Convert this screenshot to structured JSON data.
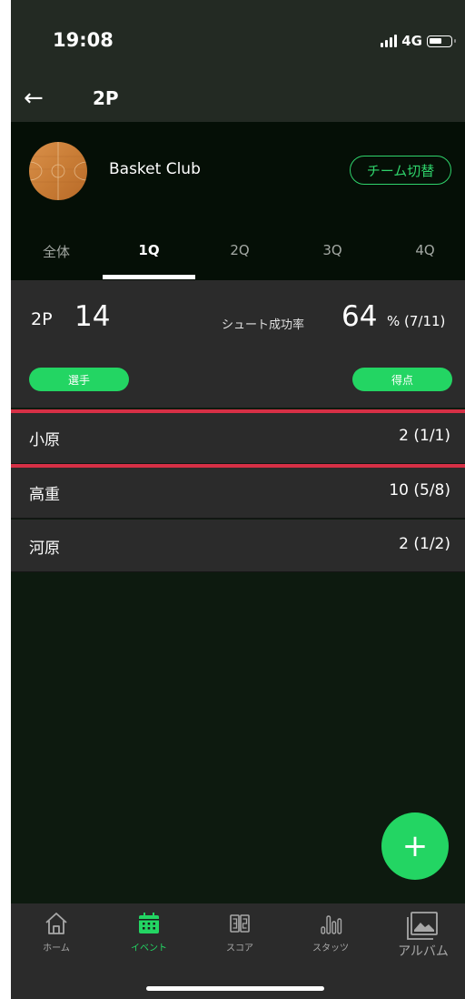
{
  "status_bar": {
    "time": "19:08",
    "network": "4G"
  },
  "header": {
    "title": "2P"
  },
  "team": {
    "name": "Basket Club",
    "switch_label": "チーム切替"
  },
  "tabs": [
    {
      "label": "全体",
      "active": false
    },
    {
      "label": "1Q",
      "active": true
    },
    {
      "label": "2Q",
      "active": false
    },
    {
      "label": "3Q",
      "active": false
    },
    {
      "label": "4Q",
      "active": false
    }
  ],
  "summary": {
    "label": "2P",
    "value": "14",
    "rate_label": "シュート成功率",
    "rate_value": "64",
    "rate_detail": "% (7/11)"
  },
  "columns": {
    "player": "選手",
    "points": "得点"
  },
  "players": [
    {
      "name": "小原",
      "score": "2 (1/1)"
    },
    {
      "name": "高重",
      "score": "10 (5/8)"
    },
    {
      "name": "河原",
      "score": "2 (1/2)"
    }
  ],
  "fab": {
    "label": "+"
  },
  "bottom_nav": [
    {
      "label": "ホーム",
      "icon": "home-icon"
    },
    {
      "label": "イベント",
      "icon": "calendar-icon",
      "active": true
    },
    {
      "label": "スコア",
      "icon": "scoreboard-icon"
    },
    {
      "label": "スタッツ",
      "icon": "bar-chart-icon"
    },
    {
      "label": "アルバム",
      "icon": "album-icon"
    }
  ],
  "colors": {
    "accent": "#23d563",
    "highlight": "#d63046",
    "row_bg": "#2b2b2b",
    "page_bg": "#0d1a0f"
  }
}
